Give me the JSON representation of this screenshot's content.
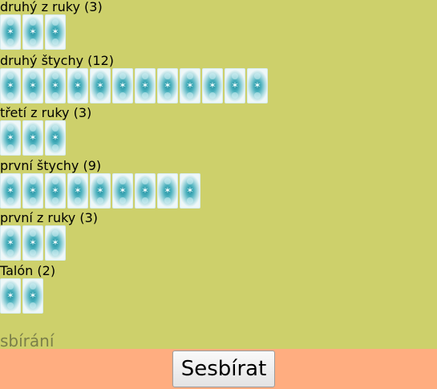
{
  "piles": [
    {
      "label": "druhý z ruky (3)",
      "count": 3
    },
    {
      "label": "druhý štychy (12)",
      "count": 12
    },
    {
      "label": "třetí z ruky (3)",
      "count": 3
    },
    {
      "label": "první štychy (9)",
      "count": 9
    },
    {
      "label": "první z ruky (3)",
      "count": 3
    },
    {
      "label": "Talón (2)",
      "count": 2
    }
  ],
  "card_back_icon": "card-back-icon",
  "status_text": "sbírání",
  "collect_button_label": "Sesbírat",
  "colors": {
    "background": "#cdd06b",
    "bar": "#ffad80"
  }
}
